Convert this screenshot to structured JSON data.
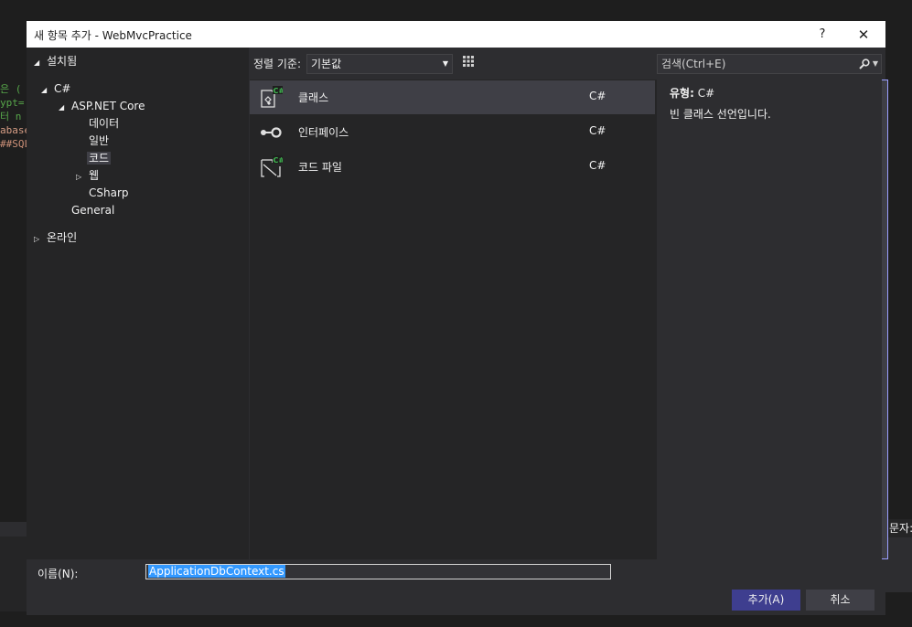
{
  "background": {
    "code_lines": [
      "은 (",
      "ypt=",
      "터 n",
      "abase",
      "##SQL"
    ],
    "right_label": "문자:"
  },
  "dialog": {
    "title": "새 항목 추가 - WebMvcPractice",
    "help_label": "?",
    "close_label": "✕"
  },
  "tree": {
    "installed": "설치됨",
    "csharp": "C#",
    "aspnet": "ASP.NET Core",
    "data": "데이터",
    "general_kr": "일반",
    "code": "코드",
    "web": "웹",
    "csharp_node": "CSharp",
    "general": "General",
    "online": "온라인"
  },
  "sort": {
    "label": "정렬 기준:",
    "value": "기본값"
  },
  "templates": [
    {
      "name": "클래스",
      "lang": "C#",
      "icon": "class-icon"
    },
    {
      "name": "인터페이스",
      "lang": "C#",
      "icon": "interface-icon"
    },
    {
      "name": "코드 파일",
      "lang": "C#",
      "icon": "code-file-icon"
    }
  ],
  "search": {
    "placeholder": "검색(Ctrl+E)"
  },
  "detail": {
    "type_label": "유형:",
    "type_value": "C#",
    "description": "빈 클래스 선언입니다."
  },
  "bottom": {
    "name_label": "이름(N):",
    "name_value": "ApplicationDbContext.cs",
    "add_label": "추가(A)",
    "cancel_label": "취소"
  },
  "colors": {
    "accent": "#3e3e8f",
    "selection": "#3399ff",
    "csharp_badge": "#3fb950"
  }
}
